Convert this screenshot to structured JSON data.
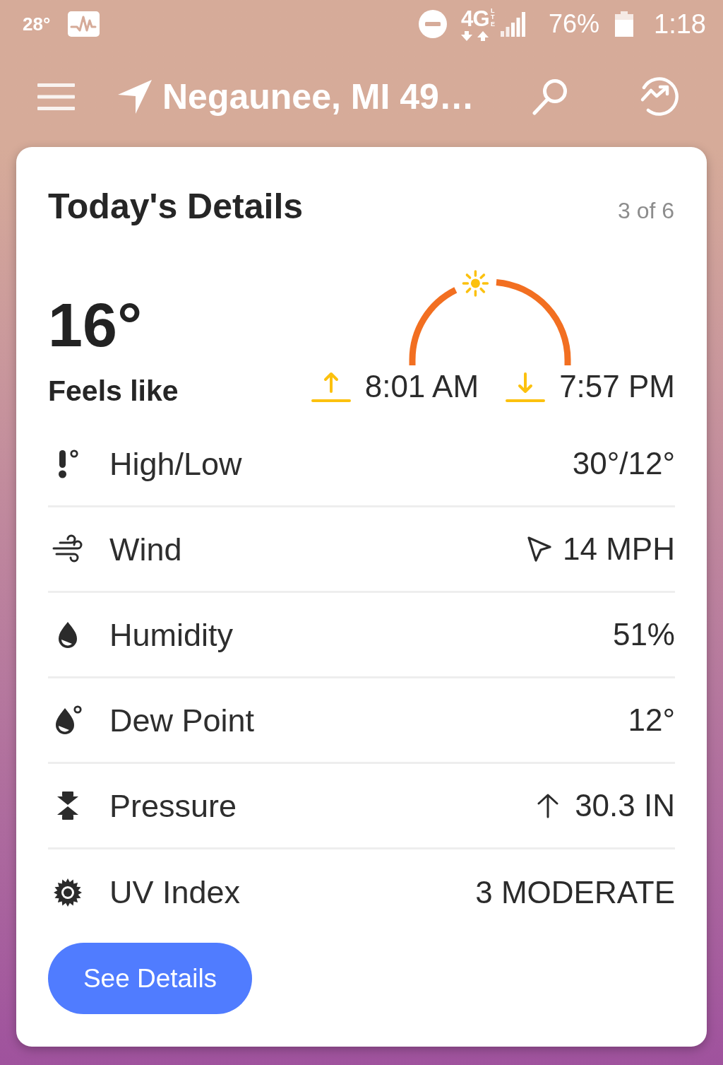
{
  "status_bar": {
    "temperature": "28°",
    "network": "4G",
    "network_type": "LTE",
    "battery": "76%",
    "time": "1:18"
  },
  "header": {
    "location": "Negaunee, MI 49…"
  },
  "card": {
    "title": "Today's Details",
    "pager": "3 of 6",
    "feels_like": {
      "value": "16°",
      "label": "Feels like"
    },
    "sun_arc": {
      "level": 0.44,
      "sunrise": "8:01 AM",
      "sunset": "7:57 PM"
    },
    "rows": [
      {
        "kind": "high_low",
        "label": "High/Low",
        "value": "30°/12°"
      },
      {
        "kind": "wind",
        "label": "Wind",
        "value": "14 MPH"
      },
      {
        "kind": "humidity",
        "label": "Humidity",
        "value": "51%"
      },
      {
        "kind": "dew_point",
        "label": "Dew Point",
        "value": "12°"
      },
      {
        "kind": "pressure",
        "label": "Pressure",
        "value": "30.3 IN",
        "rising": true
      },
      {
        "kind": "uv_index",
        "label": "UV Index",
        "value": "3 MODERATE"
      }
    ],
    "button": {
      "label": "See Details"
    }
  }
}
